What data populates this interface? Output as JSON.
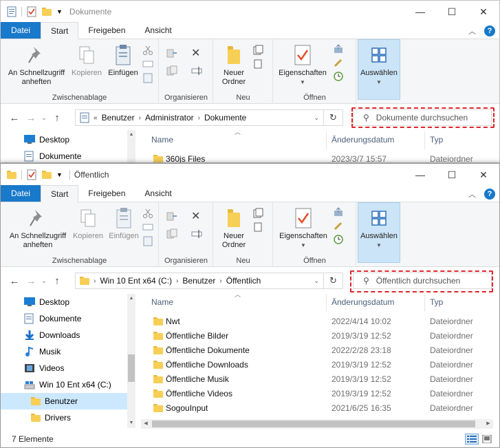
{
  "back_window": {
    "title": "Dokumente",
    "tabs": [
      "Datei",
      "Start",
      "Freigeben",
      "Ansicht"
    ],
    "ribbon": {
      "pin": "An Schnellzugriff anheften",
      "copy": "Kopieren",
      "paste": "Einfügen",
      "group_clipboard": "Zwischenablage",
      "group_organize": "Organisieren",
      "new_folder": "Neuer Ordner",
      "group_new": "Neu",
      "properties": "Eigenschaften",
      "group_open": "Öffnen",
      "select": "Auswählen"
    },
    "address": [
      "Benutzer",
      "Administrator",
      "Dokumente"
    ],
    "search_placeholder": "Dokumente durchsuchen",
    "nav_items": [
      "Desktop",
      "Dokumente"
    ],
    "columns": {
      "name": "Name",
      "date": "Änderungsdatum",
      "type": "Typ"
    },
    "rows": [
      {
        "name": "360js Files",
        "date": "2023/3/7 15:57",
        "type": "Dateiordner"
      }
    ]
  },
  "front_window": {
    "title": "Öffentlich",
    "tabs": [
      "Datei",
      "Start",
      "Freigeben",
      "Ansicht"
    ],
    "ribbon": {
      "pin": "An Schnellzugriff anheften",
      "copy": "Kopieren",
      "paste": "Einfügen",
      "group_clipboard": "Zwischenablage",
      "group_organize": "Organisieren",
      "new_folder": "Neuer Ordner",
      "group_new": "Neu",
      "properties": "Eigenschaften",
      "group_open": "Öffnen",
      "select": "Auswählen"
    },
    "address": [
      "Win 10 Ent x64 (C:)",
      "Benutzer",
      "Öffentlich"
    ],
    "search_placeholder": "Öffentlich durchsuchen",
    "nav_items": [
      {
        "label": "Desktop",
        "icon": "desktop-icon"
      },
      {
        "label": "Dokumente",
        "icon": "document-icon"
      },
      {
        "label": "Downloads",
        "icon": "download-icon"
      },
      {
        "label": "Musik",
        "icon": "music-icon"
      },
      {
        "label": "Videos",
        "icon": "video-icon"
      },
      {
        "label": "Win 10 Ent x64 (C:)",
        "icon": "drive-icon"
      },
      {
        "label": "Benutzer",
        "icon": "folder-icon",
        "selected": true
      },
      {
        "label": "Drivers",
        "icon": "folder-icon"
      }
    ],
    "columns": {
      "name": "Name",
      "date": "Änderungsdatum",
      "type": "Typ"
    },
    "rows": [
      {
        "name": "Nwt",
        "date": "2022/4/14 10:02",
        "type": "Dateiordner"
      },
      {
        "name": "Öffentliche Bilder",
        "date": "2019/3/19 12:52",
        "type": "Dateiordner"
      },
      {
        "name": "Öffentliche Dokumente",
        "date": "2022/2/28 23:18",
        "type": "Dateiordner"
      },
      {
        "name": "Öffentliche Downloads",
        "date": "2019/3/19 12:52",
        "type": "Dateiordner"
      },
      {
        "name": "Öffentliche Musik",
        "date": "2019/3/19 12:52",
        "type": "Dateiordner"
      },
      {
        "name": "Öffentliche Videos",
        "date": "2019/3/19 12:52",
        "type": "Dateiordner"
      },
      {
        "name": "SogouInput",
        "date": "2021/6/25 16:35",
        "type": "Dateiordner"
      }
    ],
    "status": "7 Elemente"
  },
  "colors": {
    "file_tab": "#1979ca",
    "highlight_box": "#e0232a",
    "selection": "#cce8ff",
    "folder": "#f7cf56"
  }
}
